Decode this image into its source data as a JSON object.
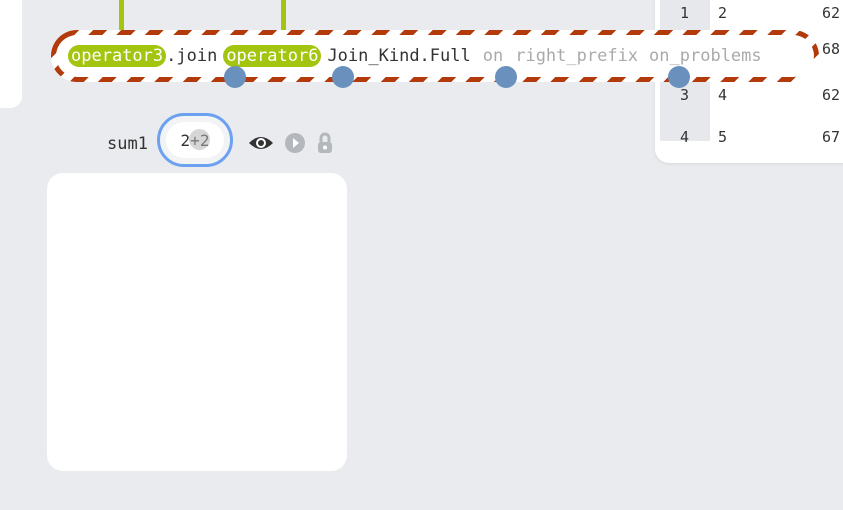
{
  "join_node": {
    "tokens": [
      {
        "text": "operator3",
        "kind": "operator"
      },
      {
        "text": ".join",
        "kind": "plain"
      },
      {
        "text": "operator6",
        "kind": "operator"
      },
      {
        "text": "Join_Kind.Full",
        "kind": "plain"
      },
      {
        "text": "on",
        "kind": "dim"
      },
      {
        "text": "right_prefix",
        "kind": "dim"
      },
      {
        "text": "on_problems",
        "kind": "dim"
      }
    ]
  },
  "table": {
    "rows": [
      {
        "index": "1",
        "c1": "2",
        "c2": "62"
      },
      {
        "index": "2",
        "c1": "",
        "c2": "68"
      },
      {
        "index": "3",
        "c1": "4",
        "c2": "62"
      },
      {
        "index": "4",
        "c1": "5",
        "c2": "67"
      }
    ]
  },
  "sum_node": {
    "label": "sum1",
    "expression": "2+2"
  },
  "icons": {
    "visibility": "eye-icon",
    "run": "play-circle-icon",
    "lock": "lock-icon"
  },
  "colors": {
    "background": "#e9ebee",
    "operator": "#a3c50f",
    "port": "#6a90bd",
    "selection": "#6ba1ef",
    "error_stripe": "#b33a0b"
  }
}
